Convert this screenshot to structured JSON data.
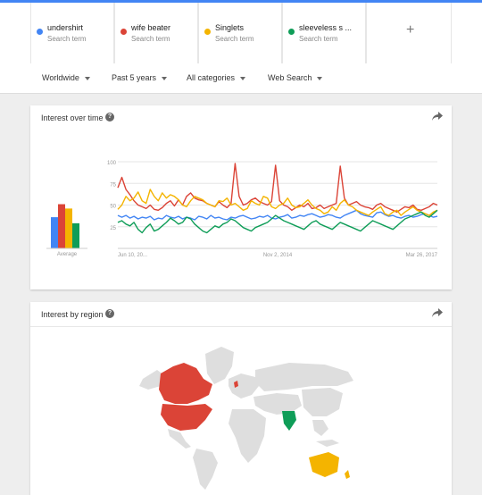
{
  "search_terms": [
    {
      "name": "undershirt",
      "subtitle": "Search term",
      "color": "#4285f4"
    },
    {
      "name": "wife beater",
      "subtitle": "Search term",
      "color": "#db4437"
    },
    {
      "name": "Singlets",
      "subtitle": "Search term",
      "color": "#f4b400"
    },
    {
      "name": "sleeveless s ...",
      "subtitle": "Search term",
      "color": "#0f9d58"
    }
  ],
  "add_term_label": "+",
  "filters": {
    "region": "Worldwide",
    "time": "Past 5 years",
    "category": "All categories",
    "property": "Web Search"
  },
  "interest_over_time": {
    "title": "Interest over time",
    "help_label": "?",
    "average_label": "Average",
    "chart_data": {
      "type": "line",
      "ylim": [
        0,
        100
      ],
      "yticks": [
        "100",
        "75",
        "50",
        "25"
      ],
      "xticks": [
        "Jun 10, 20...",
        "Nov 2, 2014",
        "Mar 26, 2017"
      ],
      "averages": [
        {
          "name": "undershirt",
          "value": 36,
          "color": "#4285f4"
        },
        {
          "name": "wife beater",
          "value": 51,
          "color": "#db4437"
        },
        {
          "name": "Singlets",
          "value": 46,
          "color": "#f4b400"
        },
        {
          "name": "sleeveless s ...",
          "value": 29,
          "color": "#0f9d58"
        }
      ],
      "series": [
        {
          "name": "undershirt",
          "color": "#4285f4",
          "values": [
            38,
            36,
            38,
            35,
            37,
            34,
            36,
            35,
            37,
            33,
            35,
            34,
            38,
            36,
            35,
            37,
            34,
            36,
            35,
            33,
            37,
            36,
            34,
            38,
            35,
            36,
            34,
            33,
            36,
            35,
            37,
            38,
            36,
            34,
            35,
            37,
            36,
            38,
            35,
            34,
            36,
            37,
            39,
            35,
            36,
            38,
            37,
            39,
            40,
            38,
            36,
            37,
            39,
            38,
            36,
            35,
            38,
            40,
            42,
            44,
            40,
            38,
            37,
            36,
            41,
            42,
            39,
            37,
            38,
            36,
            35,
            37,
            38,
            36,
            37,
            39,
            40,
            38,
            36,
            37
          ]
        },
        {
          "name": "wife beater",
          "color": "#db4437",
          "values": [
            70,
            82,
            68,
            62,
            55,
            50,
            48,
            46,
            50,
            45,
            44,
            47,
            52,
            55,
            49,
            56,
            50,
            60,
            64,
            58,
            56,
            55,
            52,
            50,
            48,
            54,
            50,
            47,
            52,
            98,
            60,
            50,
            52,
            56,
            58,
            54,
            52,
            50,
            54,
            96,
            55,
            50,
            48,
            44,
            47,
            50,
            48,
            52,
            46,
            47,
            50,
            46,
            48,
            50,
            52,
            95,
            58,
            50,
            52,
            54,
            50,
            48,
            47,
            45,
            50,
            52,
            48,
            46,
            44,
            42,
            45,
            48,
            47,
            50,
            45,
            44,
            46,
            48,
            52,
            50
          ]
        },
        {
          "name": "Singlets",
          "color": "#f4b400",
          "values": [
            45,
            50,
            60,
            55,
            58,
            65,
            55,
            52,
            68,
            60,
            55,
            64,
            58,
            62,
            60,
            56,
            50,
            48,
            55,
            60,
            58,
            56,
            52,
            50,
            48,
            55,
            54,
            58,
            50,
            52,
            48,
            44,
            46,
            55,
            52,
            50,
            60,
            58,
            48,
            46,
            50,
            52,
            58,
            50,
            47,
            48,
            52,
            56,
            50,
            46,
            44,
            40,
            42,
            48,
            44,
            52,
            56,
            50,
            48,
            44,
            42,
            40,
            38,
            42,
            45,
            48,
            40,
            38,
            42,
            44,
            38,
            42,
            45,
            48,
            44,
            42,
            40,
            38,
            42,
            44
          ]
        },
        {
          "name": "sleeveless s ...",
          "color": "#0f9d58",
          "values": [
            30,
            32,
            28,
            26,
            30,
            22,
            18,
            24,
            28,
            20,
            22,
            26,
            30,
            35,
            32,
            28,
            30,
            36,
            34,
            28,
            24,
            20,
            18,
            22,
            26,
            24,
            28,
            30,
            34,
            32,
            28,
            24,
            22,
            20,
            24,
            26,
            28,
            30,
            34,
            38,
            35,
            32,
            30,
            28,
            26,
            24,
            22,
            26,
            30,
            32,
            28,
            26,
            24,
            22,
            26,
            30,
            28,
            26,
            24,
            22,
            20,
            24,
            28,
            32,
            30,
            28,
            26,
            24,
            22,
            26,
            30,
            34,
            36,
            38,
            40,
            42,
            38,
            36,
            40,
            44
          ]
        }
      ]
    }
  },
  "interest_by_region": {
    "title": "Interest by region",
    "help_label": "?",
    "colors": {
      "land": "#dedede",
      "wife_beater": "#db4437",
      "singlets": "#f4b400",
      "sleeveless": "#0f9d58"
    }
  }
}
